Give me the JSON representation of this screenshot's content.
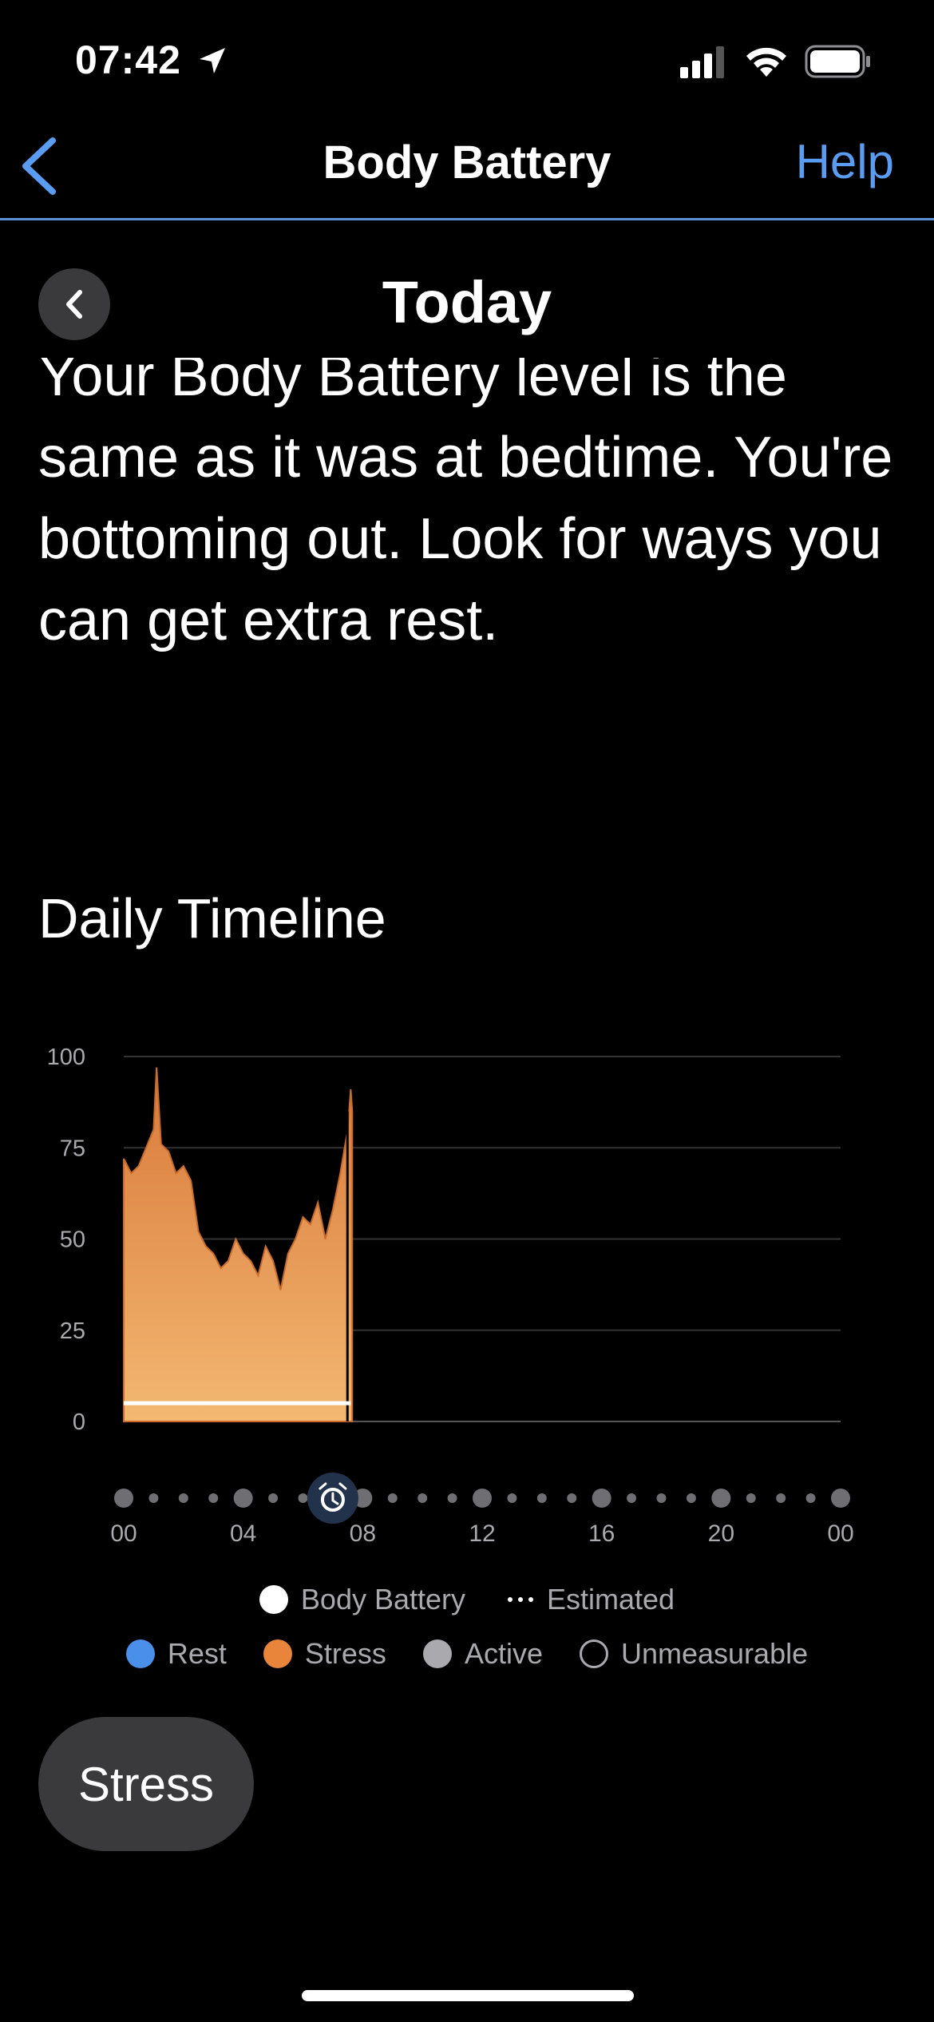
{
  "status_bar": {
    "time": "07:42"
  },
  "nav": {
    "title": "Body Battery",
    "help_label": "Help"
  },
  "date_header": {
    "title": "Today"
  },
  "description": "Your Body Battery level is the same as it was at bedtime. You're bottoming out. Look for ways you can get extra rest.",
  "timeline": {
    "title": "Daily Timeline",
    "alarm_marker_hour": 7
  },
  "chart_data": {
    "type": "area",
    "title": "",
    "xlabel": "",
    "ylabel": "",
    "ylim": [
      0,
      100
    ],
    "xlim": [
      0,
      24
    ],
    "y_ticks": [
      "0",
      "25",
      "50",
      "75",
      "100"
    ],
    "x_tick_labels": [
      "00",
      "04",
      "08",
      "12",
      "16",
      "20",
      "00"
    ],
    "grid": true,
    "series": [
      {
        "name": "Stress",
        "color": "#e8853a",
        "x": [
          0,
          0.25,
          0.5,
          0.75,
          1.0,
          1.1,
          1.25,
          1.5,
          1.75,
          2.0,
          2.25,
          2.5,
          2.75,
          3.0,
          3.25,
          3.5,
          3.75,
          4.0,
          4.25,
          4.5,
          4.75,
          5.0,
          5.25,
          5.5,
          5.75,
          6.0,
          6.25,
          6.5,
          6.75,
          7.0,
          7.25,
          7.5,
          7.6,
          7.65
        ],
        "values": [
          72,
          68,
          70,
          75,
          80,
          97,
          76,
          74,
          68,
          70,
          66,
          52,
          48,
          46,
          42,
          44,
          50,
          46,
          44,
          40,
          48,
          44,
          36,
          46,
          50,
          56,
          54,
          60,
          50,
          58,
          68,
          80,
          91,
          85
        ]
      },
      {
        "name": "Body Battery",
        "color": "#ffffff",
        "x": [
          0,
          7.6
        ],
        "values": [
          5,
          5
        ]
      }
    ]
  },
  "legend": {
    "row1": [
      {
        "label": "Body Battery",
        "color": "#ffffff",
        "style": "dot"
      },
      {
        "label": "Estimated",
        "color": "#ffffff",
        "style": "dotted-line"
      }
    ],
    "row2": [
      {
        "label": "Rest",
        "color": "#4a8fea",
        "style": "dot"
      },
      {
        "label": "Stress",
        "color": "#e8853a",
        "style": "dot"
      },
      {
        "label": "Active",
        "color": "#a9a9ae",
        "style": "dot"
      },
      {
        "label": "Unmeasurable",
        "color": "#a9a9ae",
        "style": "ring"
      }
    ]
  },
  "tabs": {
    "active_label": "Stress"
  }
}
